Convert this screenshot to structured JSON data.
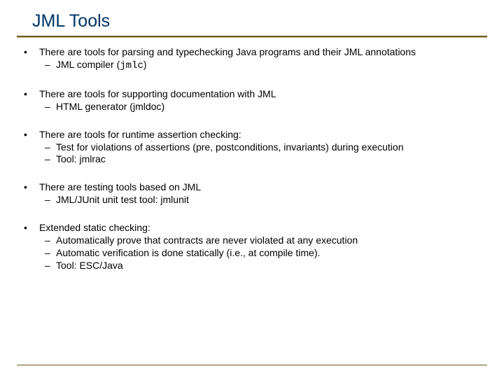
{
  "title": "JML Tools",
  "bullets": {
    "b1": {
      "text": "There are tools for parsing and typechecking Java programs and their JML annotations",
      "sub1_pre": "JML compiler (",
      "sub1_code": "jmlc",
      "sub1_post": ")"
    },
    "b2": {
      "text": "There are tools for supporting documentation with JML",
      "sub1_pre": "HTML generator (",
      "sub1_tool": "jmldoc",
      "sub1_post": ")"
    },
    "b3": {
      "text": "There are tools for runtime assertion checking:",
      "sub1": "Test for violations of assertions (pre, postconditions, invariants)   during execution",
      "sub2_pre": "Tool: ",
      "sub2_tool": "jmlrac"
    },
    "b4": {
      "text": "There are testing tools based on JML",
      "sub1_pre": "JML/JUnit unit test tool: ",
      "sub1_tool": "jmlunit"
    },
    "b5": {
      "text": "Extended static checking:",
      "sub1": "Automatically prove that contracts are never violated at any execution",
      "sub2": "Automatic verification is done statically (i.e., at compile time).",
      "sub3_pre": "Tool: ",
      "sub3_tool": "ESC/Java"
    }
  }
}
